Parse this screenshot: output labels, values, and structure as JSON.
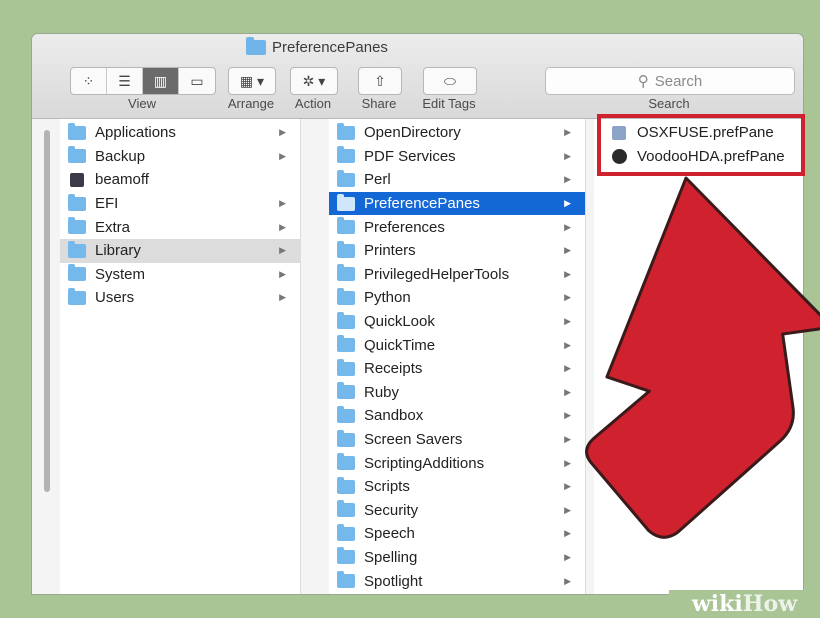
{
  "window": {
    "title": "PreferencePanes"
  },
  "toolbar": {
    "view_label": "View",
    "arrange_label": "Arrange",
    "action_label": "Action",
    "share_label": "Share",
    "edit_tags_label": "Edit Tags",
    "search_label": "Search",
    "search_placeholder": "Search"
  },
  "columns": {
    "col1": [
      {
        "label": "Applications",
        "icon": "apps-folder-icon",
        "arrow": true
      },
      {
        "label": "Backup",
        "icon": "folder-icon",
        "arrow": true
      },
      {
        "label": "beamoff",
        "icon": "executable-icon",
        "arrow": false
      },
      {
        "label": "EFI",
        "icon": "folder-icon",
        "arrow": true
      },
      {
        "label": "Extra",
        "icon": "folder-icon",
        "arrow": true
      },
      {
        "label": "Library",
        "icon": "library-folder-icon",
        "arrow": true,
        "selected": "gray"
      },
      {
        "label": "System",
        "icon": "system-folder-icon",
        "arrow": true
      },
      {
        "label": "Users",
        "icon": "users-folder-icon",
        "arrow": true
      }
    ],
    "col2": [
      {
        "label": "OpenDirectory",
        "arrow": true
      },
      {
        "label": "PDF Services",
        "arrow": true
      },
      {
        "label": "Perl",
        "arrow": true
      },
      {
        "label": "PreferencePanes",
        "arrow": true,
        "selected": "blue"
      },
      {
        "label": "Preferences",
        "arrow": true
      },
      {
        "label": "Printers",
        "arrow": true
      },
      {
        "label": "PrivilegedHelperTools",
        "arrow": true
      },
      {
        "label": "Python",
        "arrow": true
      },
      {
        "label": "QuickLook",
        "arrow": true
      },
      {
        "label": "QuickTime",
        "arrow": true
      },
      {
        "label": "Receipts",
        "arrow": true
      },
      {
        "label": "Ruby",
        "arrow": true
      },
      {
        "label": "Sandbox",
        "arrow": true
      },
      {
        "label": "Screen Savers",
        "arrow": true
      },
      {
        "label": "ScriptingAdditions",
        "arrow": true
      },
      {
        "label": "Scripts",
        "arrow": true
      },
      {
        "label": "Security",
        "arrow": true
      },
      {
        "label": "Speech",
        "arrow": true
      },
      {
        "label": "Spelling",
        "arrow": true
      },
      {
        "label": "Spotlight",
        "arrow": true
      }
    ],
    "col3": [
      {
        "label": "OSXFUSE.prefPane",
        "icon": "prefpane-icon"
      },
      {
        "label": "VoodooHDA.prefPane",
        "icon": "prefpane-dark-icon"
      }
    ]
  },
  "annotation": {
    "highlight_color": "#d0212f",
    "arrow_color": "#d0212f"
  },
  "watermark": {
    "wiki": "wiki",
    "how": "How"
  }
}
